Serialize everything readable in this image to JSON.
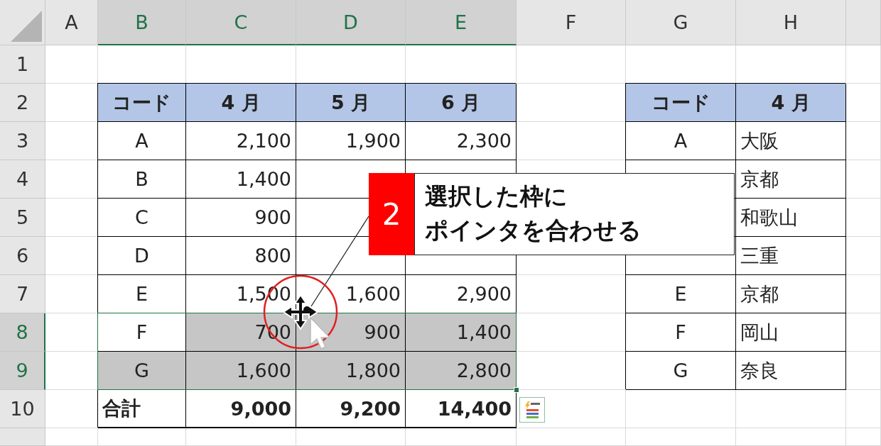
{
  "columns": [
    {
      "label": "A",
      "selected": false
    },
    {
      "label": "B",
      "selected": true
    },
    {
      "label": "C",
      "selected": true
    },
    {
      "label": "D",
      "selected": true
    },
    {
      "label": "E",
      "selected": true
    },
    {
      "label": "F",
      "selected": false
    },
    {
      "label": "G",
      "selected": false
    },
    {
      "label": "H",
      "selected": false
    }
  ],
  "rows": [
    {
      "label": "1",
      "selected": false,
      "cells": [
        {
          "kind": "empty"
        },
        {
          "kind": "empty"
        },
        {
          "kind": "empty"
        },
        {
          "kind": "empty"
        },
        {
          "kind": "empty"
        },
        {
          "kind": "empty"
        },
        {
          "kind": "empty"
        },
        {
          "kind": "empty"
        }
      ]
    },
    {
      "label": "2",
      "selected": false,
      "cells": [
        {
          "kind": "empty"
        },
        {
          "kind": "header",
          "text": "コード"
        },
        {
          "kind": "header",
          "text": "4 月"
        },
        {
          "kind": "header",
          "text": "5 月"
        },
        {
          "kind": "header",
          "text": "6 月"
        },
        {
          "kind": "empty"
        },
        {
          "kind": "header",
          "text": "コード"
        },
        {
          "kind": "header",
          "text": "4 月"
        }
      ]
    },
    {
      "label": "3",
      "selected": false,
      "cells": [
        {
          "kind": "empty"
        },
        {
          "kind": "code",
          "text": "A"
        },
        {
          "kind": "number",
          "text": "2,100"
        },
        {
          "kind": "number",
          "text": "1,900"
        },
        {
          "kind": "number",
          "text": "2,300"
        },
        {
          "kind": "empty"
        },
        {
          "kind": "code",
          "text": "A"
        },
        {
          "kind": "text",
          "text": "大阪"
        }
      ]
    },
    {
      "label": "4",
      "selected": false,
      "cells": [
        {
          "kind": "empty"
        },
        {
          "kind": "code",
          "text": "B"
        },
        {
          "kind": "number",
          "text": "1,400"
        },
        {
          "kind": "number"
        },
        {
          "kind": "number"
        },
        {
          "kind": "covered"
        },
        {
          "kind": "code"
        },
        {
          "kind": "text",
          "text": "京都"
        }
      ]
    },
    {
      "label": "5",
      "selected": false,
      "cells": [
        {
          "kind": "empty"
        },
        {
          "kind": "code",
          "text": "C"
        },
        {
          "kind": "number",
          "text": "900"
        },
        {
          "kind": "number"
        },
        {
          "kind": "number"
        },
        {
          "kind": "empty"
        },
        {
          "kind": "code"
        },
        {
          "kind": "text",
          "text": "和歌山"
        }
      ]
    },
    {
      "label": "6",
      "selected": false,
      "cells": [
        {
          "kind": "empty"
        },
        {
          "kind": "code",
          "text": "D"
        },
        {
          "kind": "number",
          "text": "800"
        },
        {
          "kind": "number"
        },
        {
          "kind": "number"
        },
        {
          "kind": "empty"
        },
        {
          "kind": "code"
        },
        {
          "kind": "text",
          "text": "三重"
        }
      ]
    },
    {
      "label": "7",
      "selected": false,
      "cells": [
        {
          "kind": "empty"
        },
        {
          "kind": "code",
          "text": "E"
        },
        {
          "kind": "number",
          "text": "1,500"
        },
        {
          "kind": "number",
          "text": "1,600"
        },
        {
          "kind": "number",
          "text": "2,900"
        },
        {
          "kind": "empty"
        },
        {
          "kind": "code",
          "text": "E"
        },
        {
          "kind": "text",
          "text": "京都"
        }
      ]
    },
    {
      "label": "8",
      "selected": true,
      "cells": [
        {
          "kind": "empty",
          "selected": false
        },
        {
          "kind": "code",
          "text": "F",
          "selected": false
        },
        {
          "kind": "number",
          "text": "700",
          "selected": true
        },
        {
          "kind": "number",
          "text": "900",
          "selected": true
        },
        {
          "kind": "number",
          "text": "1,400",
          "selected": true
        },
        {
          "kind": "empty",
          "selected": false
        },
        {
          "kind": "code",
          "text": "F",
          "selected": false
        },
        {
          "kind": "text",
          "text": "岡山",
          "selected": false
        }
      ]
    },
    {
      "label": "9",
      "selected": true,
      "cells": [
        {
          "kind": "empty",
          "selected": false
        },
        {
          "kind": "code",
          "text": "G",
          "selected": true
        },
        {
          "kind": "number",
          "text": "1,600",
          "selected": true
        },
        {
          "kind": "number",
          "text": "1,800",
          "selected": true
        },
        {
          "kind": "number",
          "text": "2,800",
          "selected": true
        },
        {
          "kind": "empty",
          "selected": false
        },
        {
          "kind": "code",
          "text": "G",
          "selected": false
        },
        {
          "kind": "text",
          "text": "奈良",
          "selected": false
        }
      ]
    },
    {
      "label": "10",
      "selected": false,
      "cells": [
        {
          "kind": "empty"
        },
        {
          "kind": "total_label",
          "text": "合計"
        },
        {
          "kind": "total",
          "text": "9,000"
        },
        {
          "kind": "total",
          "text": "9,200"
        },
        {
          "kind": "total",
          "text": "14,400"
        },
        {
          "kind": "empty"
        },
        {
          "kind": "empty"
        },
        {
          "kind": "empty"
        }
      ]
    }
  ],
  "callout": {
    "number": "2",
    "lines": [
      "選択した枠に",
      "ポインタを合わせる"
    ]
  }
}
